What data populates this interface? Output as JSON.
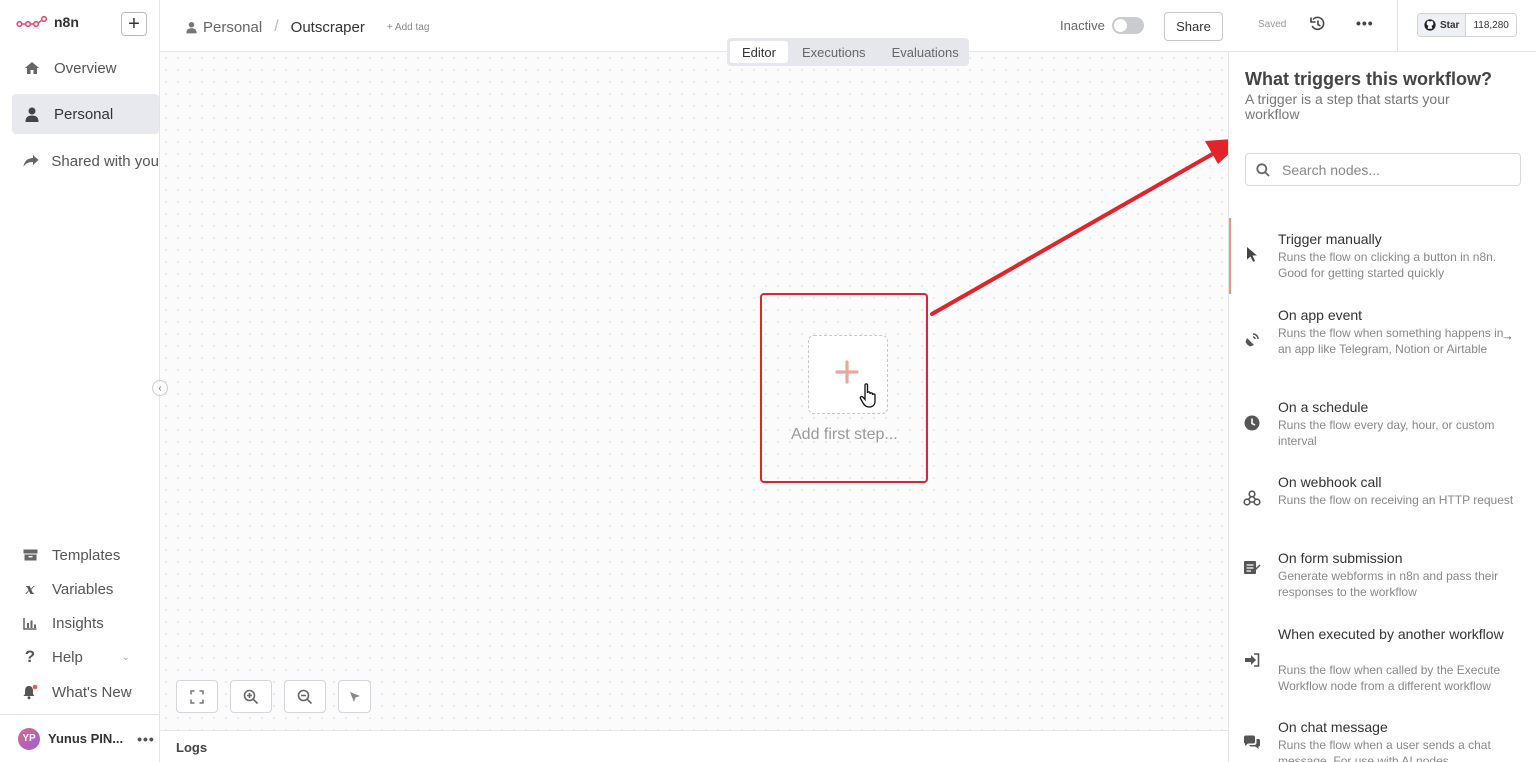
{
  "app": {
    "name": "n8n",
    "add_label": "+"
  },
  "sidebar": {
    "items": [
      {
        "label": "Overview",
        "icon": "home-icon"
      },
      {
        "label": "Personal",
        "icon": "user-icon"
      },
      {
        "label": "Shared with you",
        "icon": "share-icon"
      }
    ],
    "bottom": [
      {
        "label": "Templates",
        "icon": "box-icon"
      },
      {
        "label": "Variables",
        "icon": "variable-icon"
      },
      {
        "label": "Insights",
        "icon": "chart-icon"
      },
      {
        "label": "Help",
        "icon": "question-icon"
      },
      {
        "label": "What's New",
        "icon": "bell-icon"
      }
    ],
    "user": {
      "initials": "YP",
      "name": "Yunus PIN...",
      "more": "•••"
    }
  },
  "header": {
    "project": "Personal",
    "workflow": "Outscraper",
    "add_tag": "+ Add tag",
    "status": "Inactive",
    "share": "Share",
    "saved": "Saved",
    "github": {
      "star": "Star",
      "count": "118,280"
    }
  },
  "tabs": [
    "Editor",
    "Executions",
    "Evaluations"
  ],
  "canvas": {
    "first_step_label": "Add first step...",
    "logs_label": "Logs",
    "accent_color": "#e1242c"
  },
  "panel": {
    "title": "What triggers this workflow?",
    "subtitle": "A trigger is a step that starts your workflow",
    "search_placeholder": "Search nodes...",
    "triggers": [
      {
        "title": "Trigger manually",
        "desc": "Runs the flow on clicking a button in n8n. Good for getting started quickly",
        "icon": "cursor-icon"
      },
      {
        "title": "On app event",
        "desc": "Runs the flow when something happens in an app like Telegram, Notion or Airtable",
        "icon": "satellite-icon"
      },
      {
        "title": "On a schedule",
        "desc": "Runs the flow every day, hour, or custom interval",
        "icon": "clock-icon"
      },
      {
        "title": "On webhook call",
        "desc": "Runs the flow on receiving an HTTP request",
        "icon": "webhook-icon"
      },
      {
        "title": "On form submission",
        "desc": "Generate webforms in n8n and pass their responses to the workflow",
        "icon": "form-icon"
      },
      {
        "title": "When executed by another workflow",
        "desc": "Runs the flow when called by the Execute Workflow node from a different workflow",
        "icon": "sign-in-icon"
      },
      {
        "title": "On chat message",
        "desc": "Runs the flow when a user sends a chat message. For use with AI nodes",
        "icon": "chat-icon"
      }
    ]
  }
}
